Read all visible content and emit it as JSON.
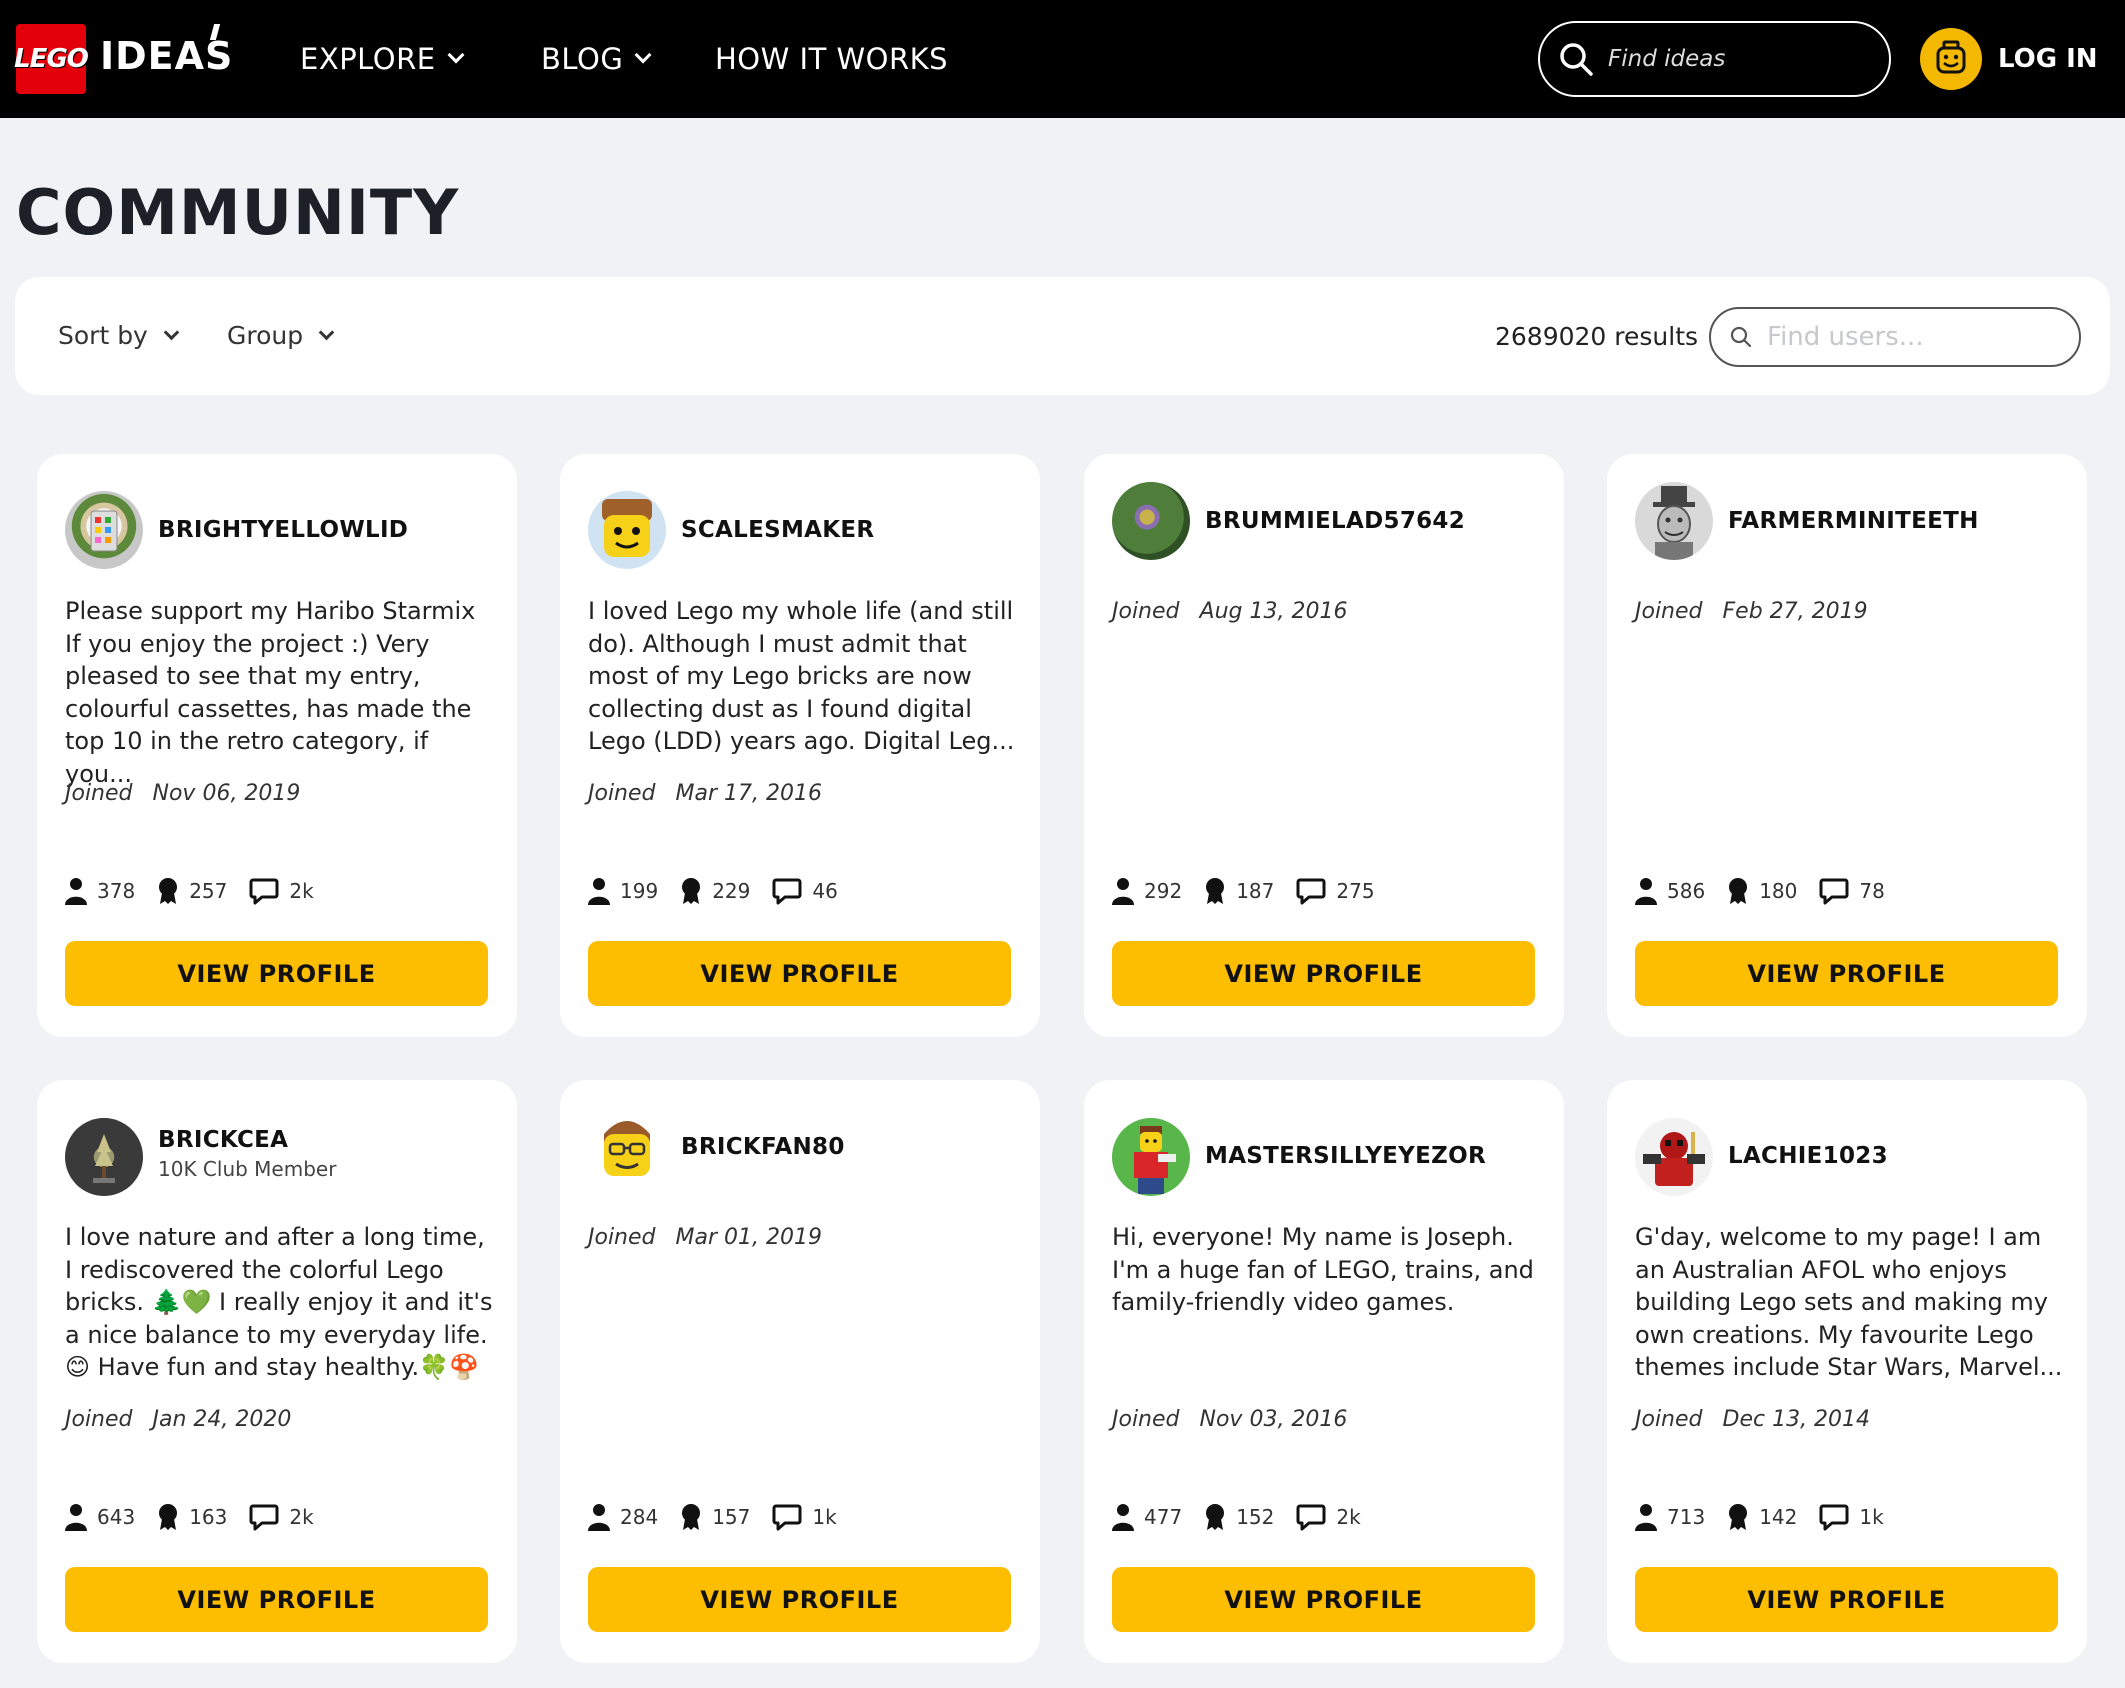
{
  "header": {
    "logo_text": "LEGO",
    "brand": "IDEAS",
    "nav": [
      {
        "label": "EXPLORE"
      },
      {
        "label": "BLOG"
      },
      {
        "label": "HOW IT WORKS"
      }
    ],
    "search_placeholder": "Find ideas",
    "login_label": "LOG IN"
  },
  "page": {
    "title": "COMMUNITY"
  },
  "filters": {
    "sort_label": "Sort by",
    "group_label": "Group",
    "results": "2689020 results",
    "user_search_placeholder": "Find users..."
  },
  "colors": {
    "accent": "#fdbd00",
    "brand_red": "#e3000b",
    "header_bg": "#000000",
    "page_bg": "#f0f2f5"
  },
  "labels": {
    "joined": "Joined",
    "view_profile": "VIEW PROFILE"
  },
  "users": [
    {
      "name": "BRIGHTYELLOWLID",
      "badge": "",
      "bio": "Please support my Haribo Starmix If you enjoy the project :) Very pleased to see that my entry, colourful cassettes, has made the top 10 in the retro category, if you...",
      "joined": "Nov 06, 2019",
      "followers": "378",
      "supporters": "257",
      "comments": "2k"
    },
    {
      "name": "SCALESMAKER",
      "badge": "",
      "bio": "I loved Lego my whole life (and still do). Although I must admit that most of my Lego bricks are now collecting dust as I found digital Lego (LDD) years ago. Digital Leg...",
      "joined": "Mar 17, 2016",
      "followers": "199",
      "supporters": "229",
      "comments": "46"
    },
    {
      "name": "BRUMMIELAD57642",
      "badge": "",
      "bio": "",
      "joined": "Aug 13, 2016",
      "followers": "292",
      "supporters": "187",
      "comments": "275"
    },
    {
      "name": "FARMERMINITEETH",
      "badge": "",
      "bio": "",
      "joined": "Feb 27, 2019",
      "followers": "586",
      "supporters": "180",
      "comments": "78"
    },
    {
      "name": "BRICKCEA",
      "badge": "10K Club Member",
      "bio": "I love nature and after a long time, I rediscovered the colorful Lego bricks. 🌲💚 I really enjoy it and it's a nice balance to my everyday life. 😊 Have fun and stay healthy.🍀🍄",
      "joined": "Jan 24, 2020",
      "followers": "643",
      "supporters": "163",
      "comments": "2k"
    },
    {
      "name": "BRICKFAN80",
      "badge": "",
      "bio": "",
      "joined": "Mar 01, 2019",
      "followers": "284",
      "supporters": "157",
      "comments": "1k"
    },
    {
      "name": "MASTERSILLYEYEZOR",
      "badge": "",
      "bio": "Hi, everyone! My name is Joseph. I'm a huge fan of LEGO, trains, and family-friendly video games.",
      "joined": "Nov 03, 2016",
      "followers": "477",
      "supporters": "152",
      "comments": "2k"
    },
    {
      "name": "LACHIE1023",
      "badge": "",
      "bio": "G'day, welcome to my page! I am an Australian AFOL who enjoys building Lego sets and making my own creations. My favourite Lego themes include Star Wars, Marvel...",
      "joined": "Dec 13, 2014",
      "followers": "713",
      "supporters": "142",
      "comments": "1k"
    }
  ]
}
